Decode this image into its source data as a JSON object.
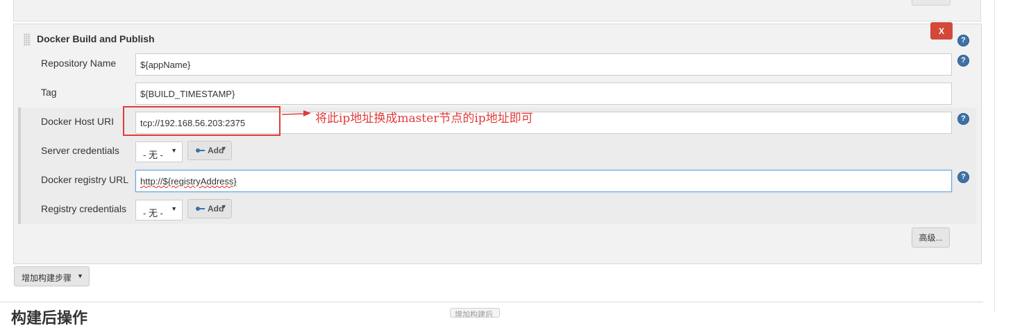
{
  "top_panel": {},
  "builder": {
    "title": "Docker Build and Publish",
    "delete_label": "X",
    "help_glyph": "?",
    "fields": {
      "repository_name": {
        "label": "Repository Name",
        "value": "${appName}"
      },
      "tag": {
        "label": "Tag",
        "value": "${BUILD_TIMESTAMP}"
      },
      "docker_host_uri": {
        "label": "Docker Host URI",
        "value": "tcp://192.168.56.203:2375"
      },
      "server_credentials": {
        "label": "Server credentials",
        "selected": "- 无 -",
        "add_label": "Add"
      },
      "docker_registry_url": {
        "label": "Docker registry URL",
        "value_prefix": "http",
        "value_rest": "://${registryAddress}"
      },
      "registry_credentials": {
        "label": "Registry credentials",
        "selected": "- 无 -",
        "add_label": "Add"
      }
    },
    "advanced_label": "高级..."
  },
  "annotation": {
    "text": "将此ip地址换成master节点的ip地址即可",
    "color": "#e23a3a"
  },
  "add_build_step": {
    "label": "增加构建步骤"
  },
  "post_build": {
    "heading": "构建后操作",
    "stub_label": "增加构建后操作步骤"
  },
  "icons": {
    "help": "help-icon",
    "key": "key-icon",
    "caret": "caret-down-icon",
    "grip": "drag-handle-icon"
  },
  "colors": {
    "panel_bg": "#f2f2f2",
    "delete_red": "#d24939",
    "help_blue": "#3d72a8",
    "focus_blue": "#66a3e0"
  }
}
